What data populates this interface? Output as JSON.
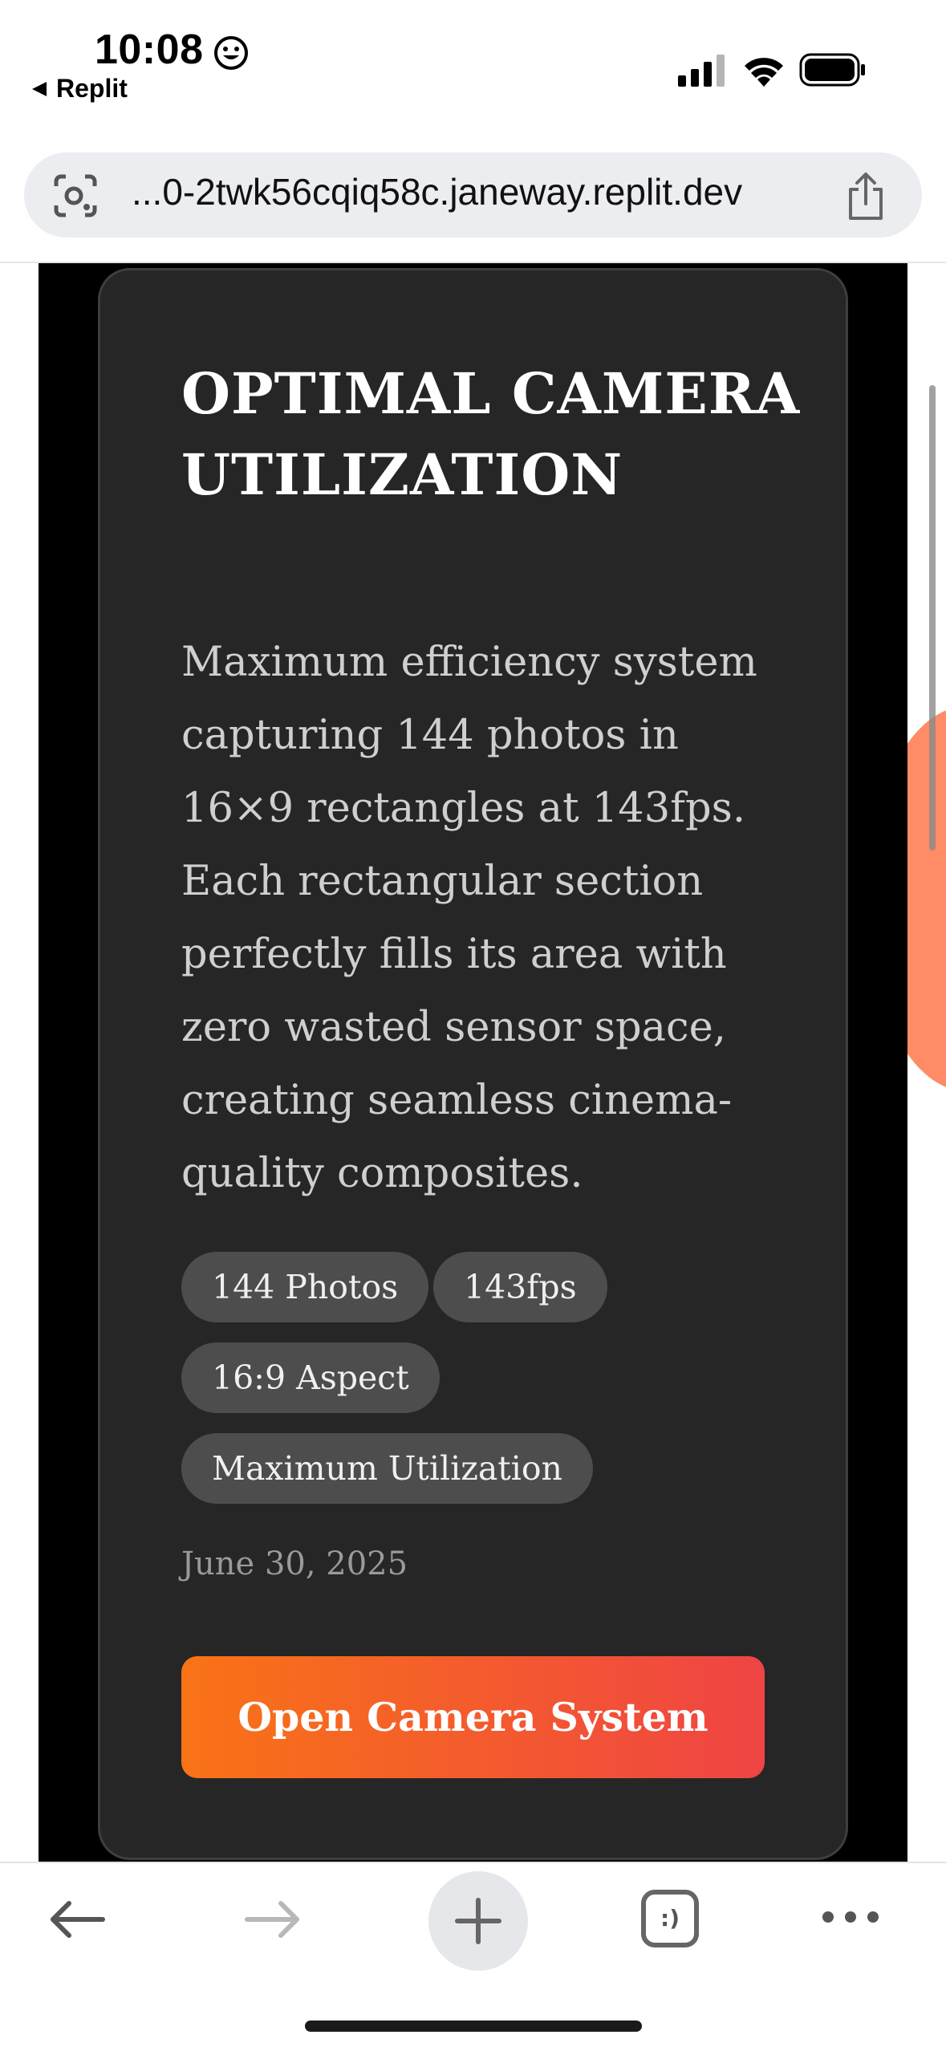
{
  "status_bar": {
    "time": "10:08",
    "back_app_label": "Replit"
  },
  "browser": {
    "url": "...0-2twk56cqiq58c.janeway.replit.dev"
  },
  "card": {
    "title": "OPTIMAL CAMERA UTILIZATION",
    "description": "Maximum efficiency system capturing 144 photos in 16×9 rectangles at 143fps. Each rectangular section perfectly fills its area with zero wasted sensor space, creating seamless cinema-quality composites.",
    "tags": [
      "144 Photos",
      "143fps",
      "16:9 Aspect",
      "Maximum Utilization"
    ],
    "date": "June 30, 2025",
    "cta_label": "Open Camera System"
  },
  "colors": {
    "card_background": "#262626",
    "page_background": "#000000",
    "tag_background": "#4d4d4d",
    "cta_gradient_start": "#f97316",
    "cta_gradient_end": "#ef4444",
    "accent_blob": "#ff8c66"
  },
  "toolbar": {
    "icons": [
      "back-arrow-icon",
      "forward-arrow-icon",
      "plus-icon",
      "tabs-icon",
      "more-icon"
    ],
    "tabs_glyph": ":)"
  }
}
